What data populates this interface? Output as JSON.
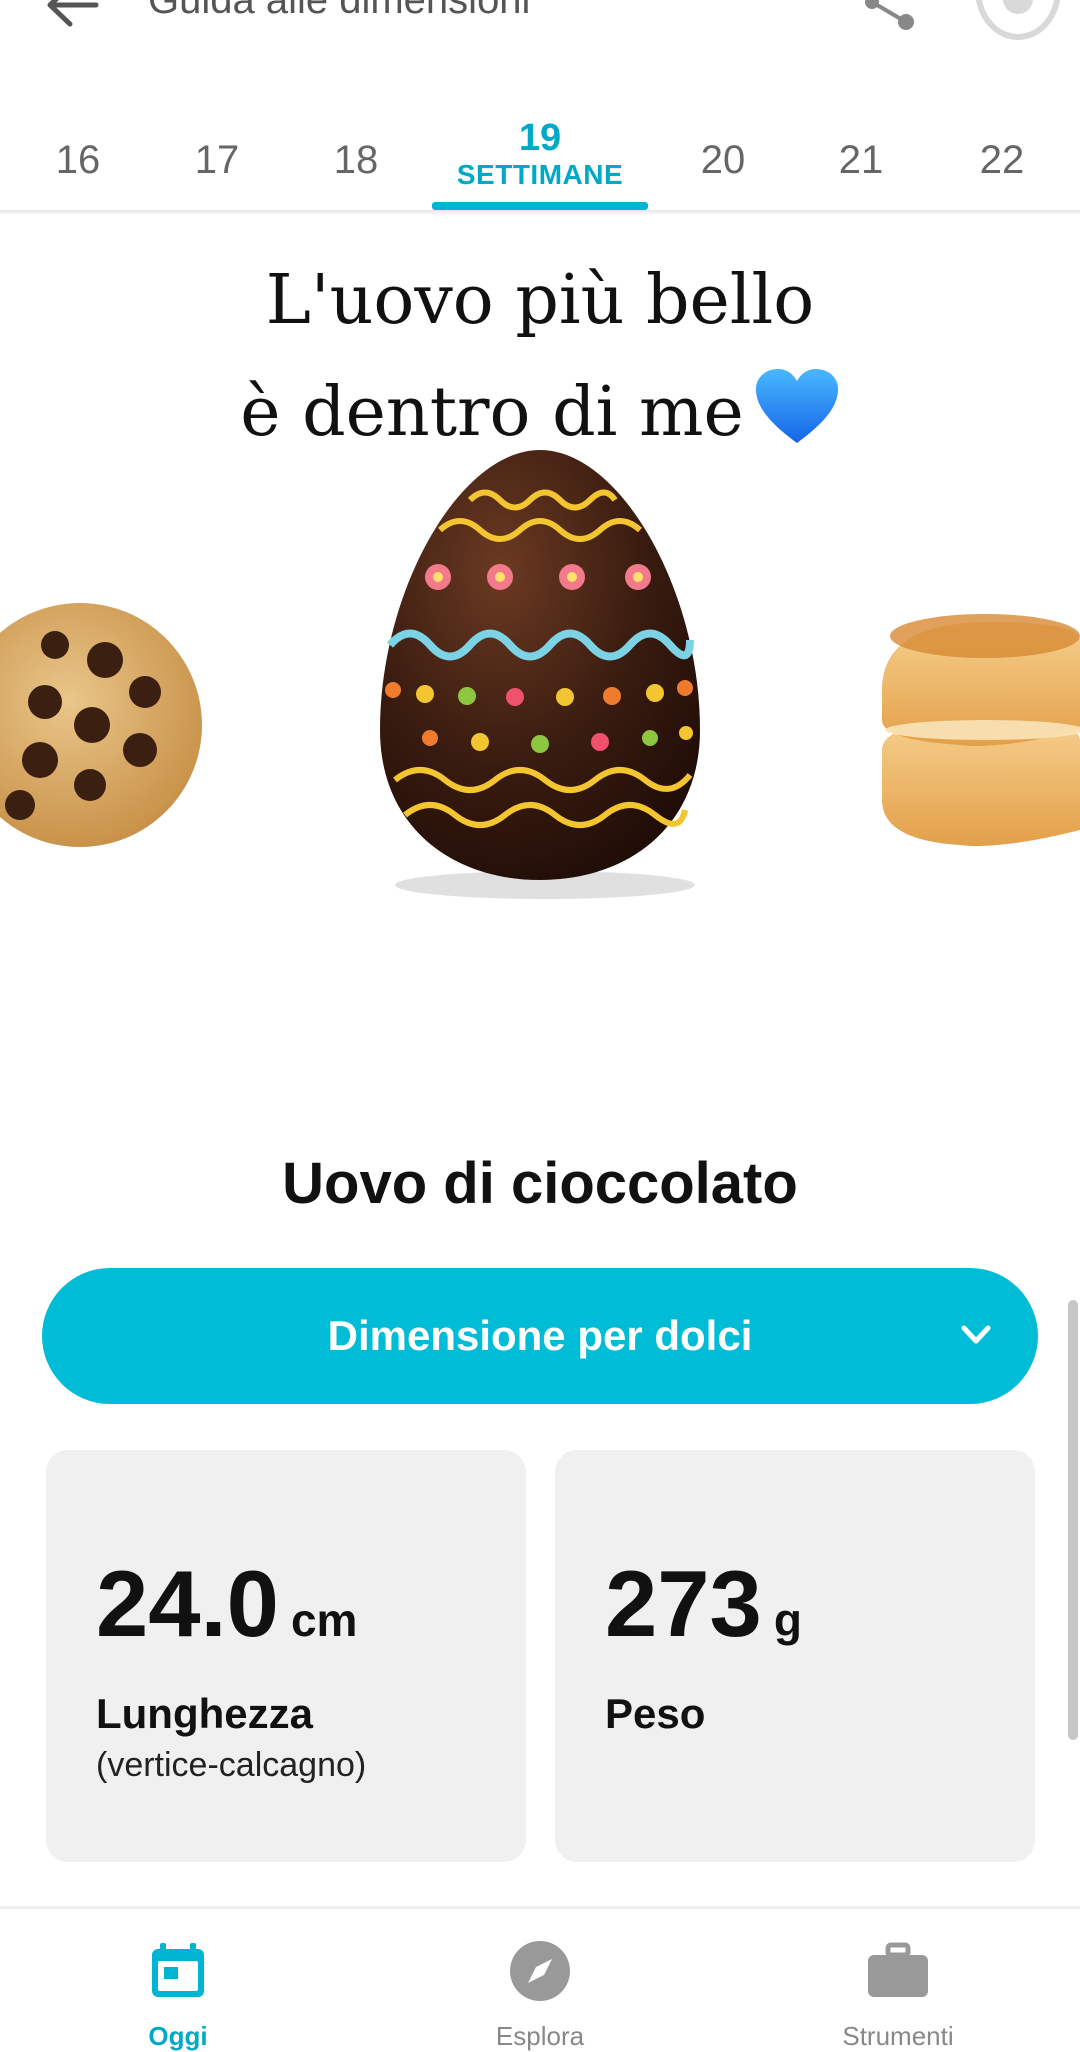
{
  "header": {
    "title": "Guida alle dimensioni",
    "back_icon": "back-arrow-icon",
    "share_icon": "share-icon",
    "avatar_icon": "avatar-icon"
  },
  "weeks": {
    "items": [
      "16",
      "17",
      "18",
      "19",
      "20",
      "21",
      "22"
    ],
    "active": "19",
    "active_label": "SETTIMANE"
  },
  "hero": {
    "line1": "L'uovo più bello",
    "line2": "è dentro di me"
  },
  "item": {
    "name": "Uovo di cioccolato"
  },
  "dropdown": {
    "label": "Dimensione per dolci"
  },
  "stats": {
    "length": {
      "value": "24.0",
      "unit": "cm",
      "label": "Lunghezza",
      "sublabel": "(vertice-calcagno)"
    },
    "weight": {
      "value": "273",
      "unit": "g",
      "label": "Peso"
    }
  },
  "bottom_nav": {
    "items": [
      {
        "label": "Oggi",
        "icon": "calendar-icon"
      },
      {
        "label": "Esplora",
        "icon": "compass-icon"
      },
      {
        "label": "Strumenti",
        "icon": "briefcase-icon"
      }
    ],
    "active": "Oggi"
  },
  "colors": {
    "accent": "#00bcd7",
    "accent_text": "#00a9c6",
    "card_bg": "#f0f0f0",
    "inactive": "#888888"
  }
}
